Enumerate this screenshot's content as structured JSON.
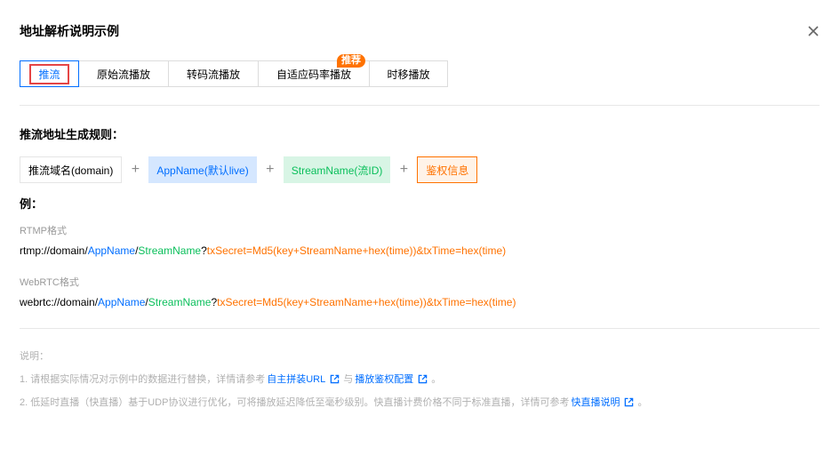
{
  "dialog": {
    "title": "地址解析说明示例"
  },
  "tabs": [
    {
      "label": "推流",
      "active": true
    },
    {
      "label": "原始流播放"
    },
    {
      "label": "转码流播放"
    },
    {
      "label": "自适应码率播放",
      "badge": "推荐"
    },
    {
      "label": "时移播放"
    }
  ],
  "rule": {
    "title": "推流地址生成规则：",
    "domain": "推流域名(domain)",
    "app": "AppName(默认live)",
    "stream": "StreamName(流ID)",
    "auth": "鉴权信息",
    "plus": "+"
  },
  "example": {
    "label": "例：",
    "rtmp": {
      "format": "RTMP格式",
      "prefix": "rtmp://domain/",
      "app": "AppName",
      "sep": "/",
      "stream": "StreamName",
      "q": "?",
      "auth": "txSecret=Md5(key+StreamName+hex(time))&txTime=hex(time)"
    },
    "webrtc": {
      "format": "WebRTC格式",
      "prefix": "webrtc://domain/",
      "app": "AppName",
      "sep": "/",
      "stream": "StreamName",
      "q": "?",
      "auth": "txSecret=Md5(key+StreamName+hex(time))&txTime=hex(time)"
    }
  },
  "notes": {
    "title": "说明：",
    "line1": {
      "text_a": "1. 请根据实际情况对示例中的数据进行替换，详情请参考",
      "link1": "自主拼装URL",
      "text_b": "与",
      "link2": "播放鉴权配置",
      "text_c": "。"
    },
    "line2": {
      "text_a": "2. 低延时直播（快直播）基于UDP协议进行优化，可将播放延迟降低至毫秒级别。快直播计费价格不同于标准直播，详情可参考",
      "link": "快直播说明",
      "text_c": "。"
    }
  },
  "colors": {
    "primary": "#006eff",
    "green": "#0abf5b",
    "orange": "#ff7200",
    "highlight_border": "#e54545"
  }
}
